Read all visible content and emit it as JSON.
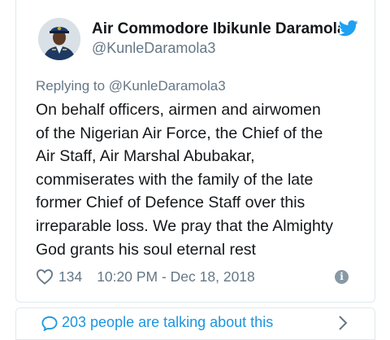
{
  "author": {
    "display_name": "Air Commodore Ibikunle Daramola",
    "handle": "@KunleDaramola3",
    "avatar_icon": "officer-avatar",
    "platform_icon": "twitter-bird-icon"
  },
  "tweet": {
    "replying_to": "Replying to @KunleDaramola3",
    "lines": [
      "On behalf officers, airmen and airwomen",
      "of the Nigerian Air Force, the Chief of the",
      "Air Staff, Air Marshal Abubakar,",
      "commiserates with the family of the late",
      "former Chief of Defence Staff over this",
      "irreparable loss. We pray that the Almighty",
      "God grants his soul eternal rest"
    ],
    "likes": "134",
    "timestamp": "10:20 PM - Dec 18, 2018",
    "info_icon": "i"
  },
  "conversation": {
    "label": "203 people are talking about this"
  },
  "colors": {
    "text": "#14171a",
    "muted": "#657786",
    "accent": "#1b95e0",
    "border": "#e1e8ed"
  }
}
